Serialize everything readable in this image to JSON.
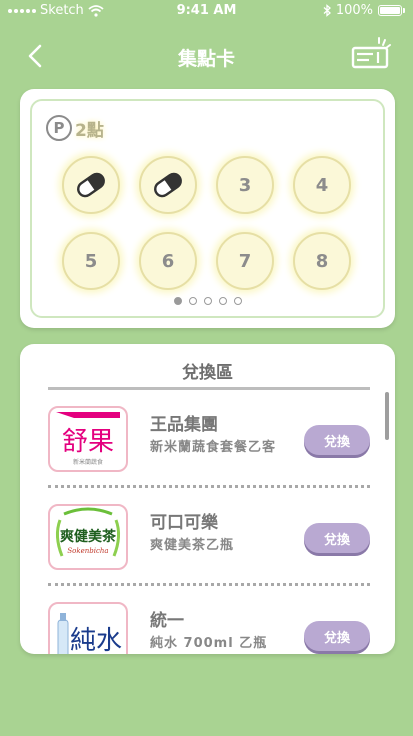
{
  "status_bar": {
    "carrier": "Sketch",
    "time": "9:41 AM",
    "battery": "100%"
  },
  "nav": {
    "title": "集點卡"
  },
  "stamp_card": {
    "points_symbol": "P",
    "points_label": "2點",
    "stamps": [
      {
        "label": "",
        "stamped": true
      },
      {
        "label": "",
        "stamped": true
      },
      {
        "label": "3",
        "stamped": false
      },
      {
        "label": "4",
        "stamped": false
      },
      {
        "label": "5",
        "stamped": false
      },
      {
        "label": "6",
        "stamped": false
      },
      {
        "label": "7",
        "stamped": false
      },
      {
        "label": "8",
        "stamped": false
      }
    ],
    "pages": 5,
    "current_page": 1
  },
  "exchange": {
    "title": "兌換區",
    "items": [
      {
        "brand": "王品集團",
        "desc": "新米蘭蔬食套餐乙客",
        "button": "兌換",
        "logo_text": "舒果",
        "logo_sub": "新米蘭蔬食"
      },
      {
        "brand": "可口可樂",
        "desc": "爽健美茶乙瓶",
        "button": "兌換",
        "logo_text": "爽健美茶",
        "logo_sub": "Sokenbicha"
      },
      {
        "brand": "統一",
        "desc": "純水 700ml 乙瓶",
        "button": "兌換",
        "logo_text": "純水",
        "logo_sub": ""
      }
    ]
  },
  "colors": {
    "background": "#a9d392",
    "button": "#b9a9d2",
    "logo_pink": "#e4007f",
    "logo_green": "#2f8f2f",
    "logo_blue": "#1a3b8c"
  }
}
